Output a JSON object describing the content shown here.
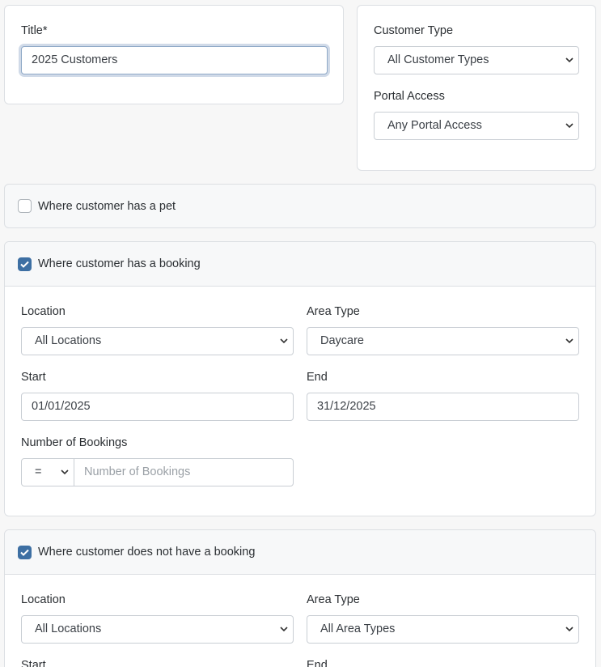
{
  "title_card": {
    "label": "Title*",
    "value": "2025 Customers"
  },
  "filters_card": {
    "customer_type_label": "Customer Type",
    "customer_type_value": "All Customer Types",
    "portal_access_label": "Portal Access",
    "portal_access_value": "Any Portal Access"
  },
  "pet_section": {
    "label": "Where customer has a pet",
    "checked": false
  },
  "booking_section": {
    "label": "Where customer has a booking",
    "checked": true,
    "location_label": "Location",
    "location_value": "All Locations",
    "area_type_label": "Area Type",
    "area_type_value": "Daycare",
    "start_label": "Start",
    "start_value": "01/01/2025",
    "end_label": "End",
    "end_value": "31/12/2025",
    "num_bookings_label": "Number of Bookings",
    "operator_value": "=",
    "num_bookings_placeholder": "Number of Bookings"
  },
  "no_booking_section": {
    "label": "Where customer does not have a booking",
    "checked": true,
    "location_label": "Location",
    "location_value": "All Locations",
    "area_type_label": "Area Type",
    "area_type_value": "All Area Types",
    "start_label": "Start",
    "end_label": "End"
  },
  "colors": {
    "accent": "#3d6fa3",
    "border": "#dcdfe3",
    "background": "#f7f7f7"
  }
}
